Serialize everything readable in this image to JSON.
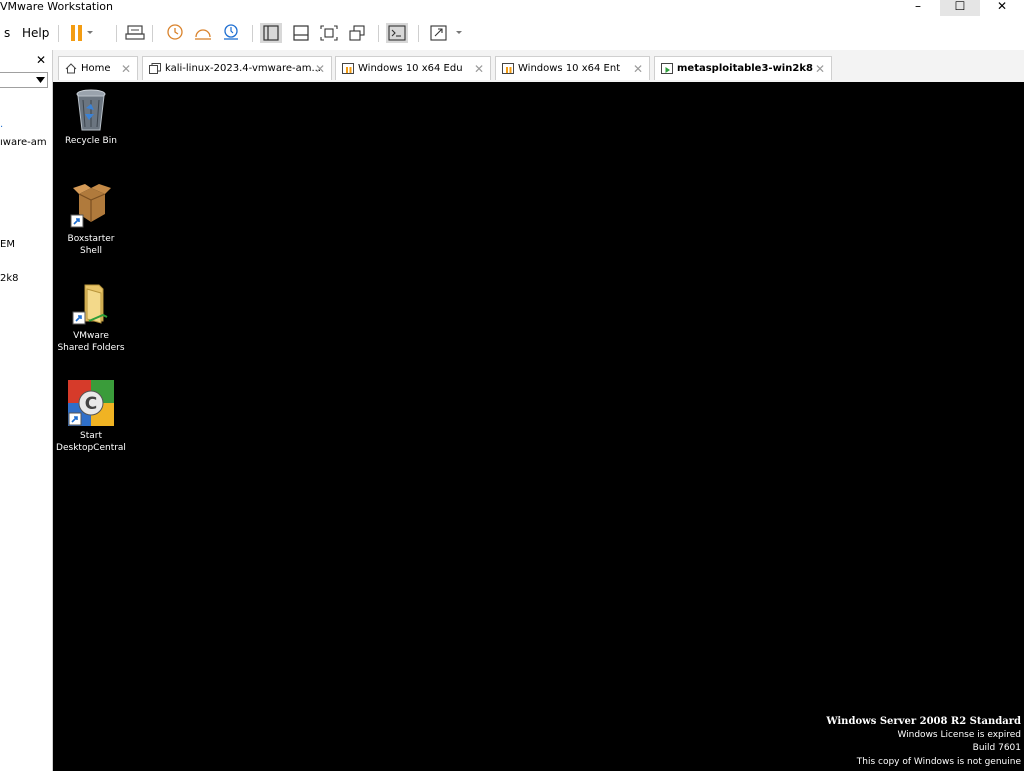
{
  "window": {
    "title": "VMware Workstation",
    "min_glyph": "–",
    "max_glyph": "☐",
    "close_glyph": "✕"
  },
  "toolbar": {
    "menu_partial": "s",
    "help_label": "Help"
  },
  "sidebar": {
    "close_glyph": "✕",
    "items": [
      {
        "label": "ıware-am"
      },
      {
        "label": "EM"
      },
      {
        "label": "2k8"
      }
    ]
  },
  "tabs": [
    {
      "label": "Home",
      "icon": "home-icon",
      "close": "✕"
    },
    {
      "label": "kali-linux-2023.4-vmware-am...",
      "icon": "vm-icon",
      "close": "✕"
    },
    {
      "label": "Windows 10 x64 Edu",
      "icon": "vm-paused-icon",
      "close": "✕"
    },
    {
      "label": "Windows 10 x64 Ent",
      "icon": "vm-paused-icon",
      "close": "✕"
    },
    {
      "label": "metasploitable3-win2k8",
      "icon": "vm-running-icon",
      "close": "✕",
      "active": true
    }
  ],
  "desktop": {
    "icons": [
      {
        "label_line1": "Recycle Bin",
        "label_line2": "",
        "icon": "recycle-bin-icon"
      },
      {
        "label_line1": "Boxstarter",
        "label_line2": "Shell",
        "icon": "box-icon"
      },
      {
        "label_line1": "VMware",
        "label_line2": "Shared Folders",
        "icon": "shared-folder-icon"
      },
      {
        "label_line1": "Start",
        "label_line2": "DesktopCentral",
        "icon": "desktop-central-icon"
      }
    ],
    "watermark": {
      "title": "Windows Server 2008 R2 Standard",
      "line2": "Windows License is expired",
      "line3": "Build 7601",
      "line4": "This copy of Windows is not genuine"
    }
  },
  "colors": {
    "vm_background": "#000000",
    "pause_orange": "#f39c12",
    "accent_blue": "#1f6fd1"
  }
}
